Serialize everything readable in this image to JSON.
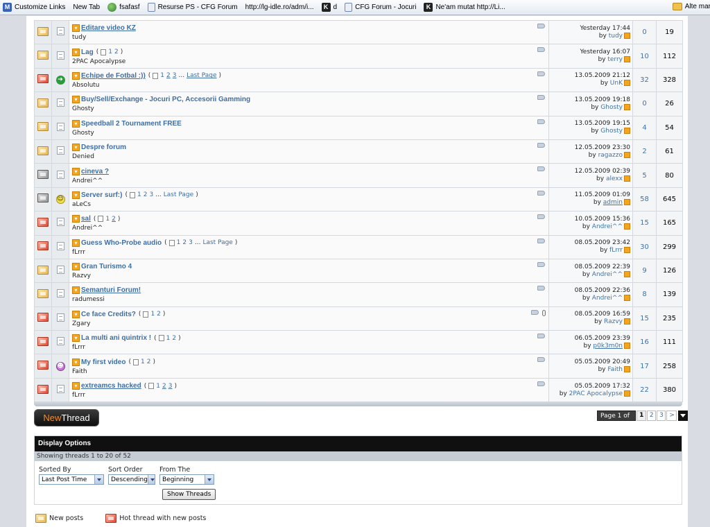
{
  "bookmarks": [
    {
      "icon": "msn-icon",
      "label": "Customize Links"
    },
    {
      "icon": "page-icon",
      "label": "New Tab"
    },
    {
      "icon": "globe-icon",
      "label": "fsafasf"
    },
    {
      "icon": "document-icon",
      "label": "Resurse PS - CFG Forum"
    },
    {
      "icon": "page-icon",
      "label": "http://lg-idle.ro/adm/i..."
    },
    {
      "icon": "k-icon",
      "label": "d"
    },
    {
      "icon": "document-icon",
      "label": "CFG Forum - Jocuri"
    },
    {
      "icon": "k-icon",
      "label": "Ne'am mutat http://Li..."
    }
  ],
  "bookmarks_right": "Alte mar",
  "threads": [
    {
      "status": "normal",
      "emoticon": "",
      "title": "Editare video KZ",
      "underlined": true,
      "pages": [],
      "author": "tudy",
      "clip": false,
      "date": "Yesterday 17:44",
      "by": "by",
      "last_user": "tudy",
      "last_user_underlined": false,
      "replies": "0",
      "views": "19"
    },
    {
      "status": "normal",
      "emoticon": "",
      "title": "Lag",
      "underlined": false,
      "pages": [
        "1",
        "2"
      ],
      "author": "2PAC Apocalypse",
      "clip": false,
      "date": "Yesterday 16:07",
      "by": "by",
      "last_user": "terry",
      "last_user_underlined": false,
      "replies": "10",
      "views": "112"
    },
    {
      "status": "hot",
      "emoticon": "arrow",
      "title": "Echipe de Fotbal :))",
      "underlined": true,
      "pages": [
        "1",
        "2",
        "3",
        "...",
        "Last Page"
      ],
      "author": "Absolutu",
      "clip": false,
      "date": "13.05.2009 21:12",
      "by": "by",
      "last_user": "UnK",
      "last_user_underlined": false,
      "replies": "32",
      "views": "328"
    },
    {
      "status": "normal",
      "emoticon": "",
      "title": "Buy/Sell/Exchange - Jocuri PC, Accesorii Gamming",
      "underlined": false,
      "pages": [],
      "author": "Ghosty",
      "clip": false,
      "date": "13.05.2009 19:18",
      "by": "by",
      "last_user": "Ghosty",
      "last_user_underlined": false,
      "replies": "0",
      "views": "26"
    },
    {
      "status": "normal",
      "emoticon": "",
      "title": "Speedball 2 Tournament FREE",
      "underlined": false,
      "pages": [],
      "author": "Ghosty",
      "clip": false,
      "date": "13.05.2009 19:15",
      "by": "by",
      "last_user": "Ghosty",
      "last_user_underlined": false,
      "replies": "4",
      "views": "54"
    },
    {
      "status": "normal",
      "emoticon": "",
      "title": "Despre forum",
      "underlined": false,
      "pages": [],
      "author": "Denied",
      "clip": false,
      "date": "12.05.2009 23:30",
      "by": "by",
      "last_user": "ragazzo",
      "last_user_underlined": false,
      "replies": "2",
      "views": "61"
    },
    {
      "status": "lock",
      "emoticon": "",
      "title": "cineva ?",
      "underlined": true,
      "pages": [],
      "author": "Andrei^^",
      "clip": false,
      "date": "12.05.2009 02:39",
      "by": "by",
      "last_user": "alexx",
      "last_user_underlined": false,
      "replies": "5",
      "views": "80"
    },
    {
      "status": "lock",
      "emoticon": "smile",
      "title": "Server surf:)",
      "underlined": false,
      "pages": [
        "1",
        "2",
        "3",
        "...",
        "Last Page"
      ],
      "author": "aLeCs",
      "clip": false,
      "date": "11.05.2009 01:09",
      "by": "by",
      "last_user": "admin",
      "last_user_underlined": true,
      "replies": "58",
      "views": "645"
    },
    {
      "status": "hot",
      "emoticon": "",
      "title": "sal",
      "underlined": true,
      "pages": [
        "1",
        "2"
      ],
      "author": "Andrei^^",
      "clip": false,
      "date": "10.05.2009 15:36",
      "by": "by",
      "last_user": "Andrei^^",
      "last_user_underlined": false,
      "replies": "15",
      "views": "165"
    },
    {
      "status": "hot",
      "emoticon": "",
      "title": "Guess Who-Probe audio",
      "underlined": false,
      "pages": [
        "1",
        "2",
        "3",
        "...",
        "Last Page"
      ],
      "author": "fLrrr",
      "clip": false,
      "date": "08.05.2009 23:42",
      "by": "by",
      "last_user": "fLrrr",
      "last_user_underlined": false,
      "replies": "30",
      "views": "299"
    },
    {
      "status": "normal",
      "emoticon": "",
      "title": "Gran Turismo 4",
      "underlined": false,
      "pages": [],
      "author": "Razvy",
      "clip": false,
      "date": "08.05.2009 22:39",
      "by": "by",
      "last_user": "Andrei^^",
      "last_user_underlined": false,
      "replies": "9",
      "views": "126"
    },
    {
      "status": "normal",
      "emoticon": "",
      "title": "Semanturi Forum!",
      "underlined": true,
      "pages": [],
      "author": "radumessi",
      "clip": false,
      "date": "08.05.2009 22:36",
      "by": "by",
      "last_user": "Andrei^^",
      "last_user_underlined": false,
      "replies": "8",
      "views": "139"
    },
    {
      "status": "hot",
      "emoticon": "",
      "title": "Ce face Credits?",
      "underlined": false,
      "pages": [
        "1",
        "2"
      ],
      "author": "Zgary",
      "clip": true,
      "date": "08.05.2009 16:59",
      "by": "by",
      "last_user": "Razvy",
      "last_user_underlined": false,
      "replies": "15",
      "views": "235"
    },
    {
      "status": "hot",
      "emoticon": "",
      "title": "La multi ani quintrix !",
      "underlined": false,
      "pages": [
        "1",
        "2"
      ],
      "author": "fLrrr",
      "clip": false,
      "date": "06.05.2009 23:39",
      "by": "by",
      "last_user": "p0k3m0n",
      "last_user_underlined": true,
      "replies": "16",
      "views": "111"
    },
    {
      "status": "hot",
      "emoticon": "grin",
      "title": "My first video",
      "underlined": false,
      "pages": [
        "1",
        "2"
      ],
      "author": "Faith",
      "clip": false,
      "date": "05.05.2009 20:49",
      "by": "by",
      "last_user": "Faith",
      "last_user_underlined": false,
      "replies": "17",
      "views": "258"
    },
    {
      "status": "hot",
      "emoticon": "",
      "title": "extreamcs hacked",
      "underlined": true,
      "pages": [
        "1",
        "2",
        "3"
      ],
      "author": "fLrrr",
      "clip": false,
      "date": "05.05.2009 17:32",
      "by": "by",
      "last_user": "2PAC Apocalypse",
      "last_user_underlined": false,
      "replies": "22",
      "views": "380"
    }
  ],
  "new_thread": {
    "part1": "New",
    "part2": "Thread"
  },
  "pagination": {
    "label": "Page 1 of 3",
    "pages": [
      "1",
      "2",
      "3",
      ">"
    ],
    "current": "1"
  },
  "display_options": {
    "title": "Display Options",
    "subtitle": "Showing threads 1 to 20 of 52",
    "sorted_by_label": "Sorted By",
    "sorted_by_value": "Last Post Time",
    "sort_order_label": "Sort Order",
    "sort_order_value": "Descending",
    "from_label": "From The",
    "from_value": "Beginning",
    "button": "Show Threads"
  },
  "legend": {
    "new_posts": "New posts",
    "hot_thread": "Hot thread with new posts"
  },
  "colors": {
    "link": "#3f6ea3",
    "accent": "#f2a51d",
    "header": "#101010"
  }
}
